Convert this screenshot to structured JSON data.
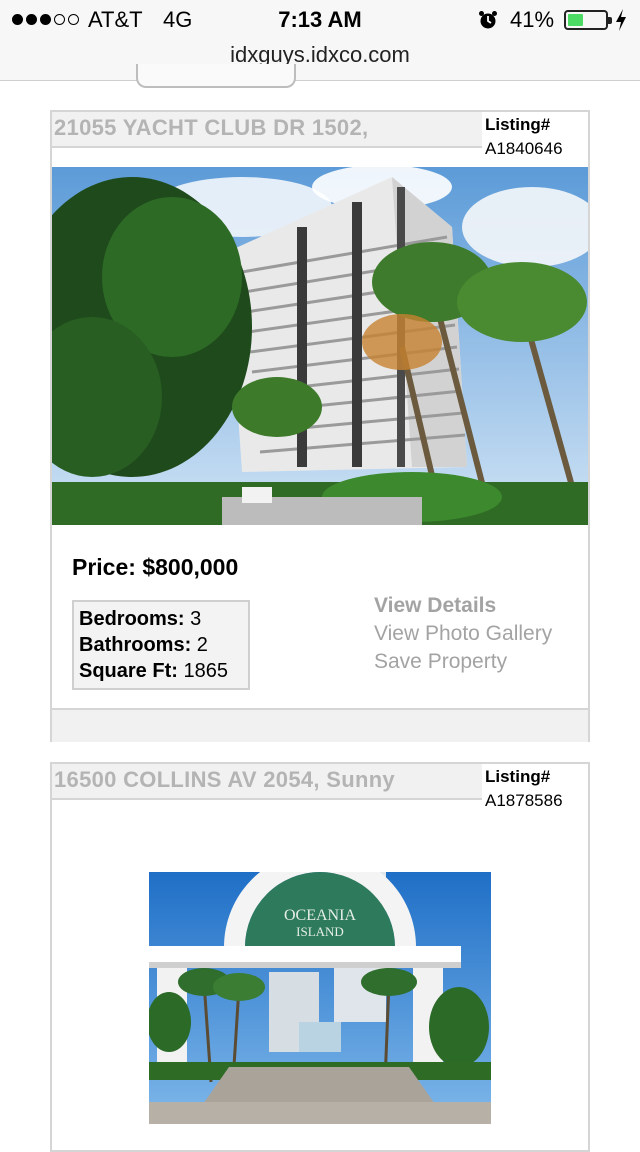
{
  "status_bar": {
    "carrier": "AT&T",
    "network": "4G",
    "time": "7:13 AM",
    "battery_percent": "41%",
    "battery_level": 0.41,
    "signal_bars_filled": 3,
    "signal_bars_total": 5,
    "icons": [
      "alarm-icon",
      "battery-icon",
      "charging-icon"
    ]
  },
  "browser": {
    "url": "idxguys.idxco.com"
  },
  "colors": {
    "address_text": "#b4b4b4",
    "link_text": "#a3a3a3",
    "card_border": "#d5d5d5",
    "battery_fill": "#4cd964"
  },
  "listings": [
    {
      "address": "21055 YACHT CLUB DR 1502,",
      "listing_label": "Listing#",
      "listing_number": "A1840646",
      "photo": "high-rise-condo-with-palm-trees",
      "price": "Price: $800,000",
      "bedrooms_label": "Bedrooms:",
      "bedrooms": "3",
      "bathrooms_label": "Bathrooms:",
      "bathrooms": "2",
      "sqft_label": "Square Ft:",
      "sqft": "1865",
      "view_details": "View Details",
      "view_gallery": "View Photo Gallery",
      "save_property": "Save Property"
    },
    {
      "address": "16500 COLLINS AV 2054,  Sunny",
      "listing_label": "Listing#",
      "listing_number": "A1878586",
      "photo": "oceania-island-entrance",
      "photo_sign_text": "OCEANIA ISLAND"
    }
  ]
}
